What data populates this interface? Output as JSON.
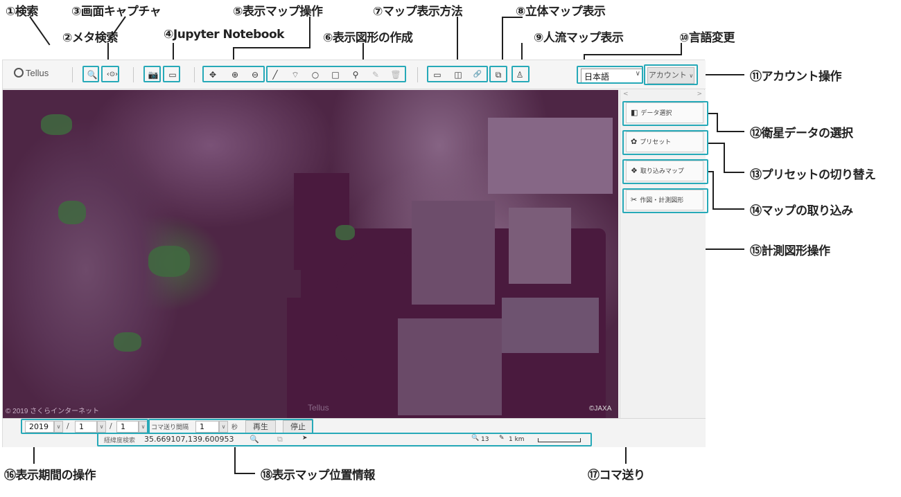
{
  "annotations": {
    "a1": "①検索",
    "a2": "②メタ検索",
    "a3": "③画面キャプチャ",
    "a4": "④Jupyter Notebook",
    "a5": "⑤表示マップ操作",
    "a6": "⑥表示図形の作成",
    "a7": "⑦マップ表示方法",
    "a8": "⑧立体マップ表示",
    "a9": "⑨人流マップ表示",
    "a10": "⑩言語変更",
    "a11": "⑪アカウント操作",
    "a12": "⑫衛星データの選択",
    "a13": "⑬プリセットの切り替え",
    "a14": "⑭マップの取り込み",
    "a15": "⑮計測図形操作",
    "a16": "⑯表示期間の操作",
    "a17": "⑰コマ送り",
    "a18": "⑱表示マップ位置情報"
  },
  "toolbar": {
    "logo": "Tellus",
    "language": "日本語",
    "account": "アカウント",
    "icons": {
      "search": "🔍",
      "meta": "‹⊙›",
      "capture": "📷",
      "notebook": "▭",
      "move": "✥",
      "zoom_in": "⊕",
      "zoom_out": "⊖",
      "line": "╱",
      "lasso": "⌔",
      "circle": "○",
      "rect": "□",
      "pin": "⚲",
      "edit": "✎",
      "trash": "🗑",
      "single": "▭",
      "split": "◫",
      "link": "🔗",
      "cube": "⧉",
      "person": "♙"
    }
  },
  "map": {
    "credit_left": "© 2019 さくらインターネット",
    "credit_right": "©JAXA",
    "watermark": "Tellus"
  },
  "panel": {
    "arrow_left": "<",
    "arrow_right": ">",
    "data_select": "データ選択",
    "preset": "プリセット",
    "import_map": "取り込みマップ",
    "drawing": "作図・計測図形",
    "icons": {
      "data": "◧",
      "preset": "✿",
      "import": "❖",
      "drawing": "✂"
    }
  },
  "time": {
    "year": "2019",
    "month": "1",
    "day": "1",
    "sep": "/",
    "interval_label": "コマ送り間隔",
    "interval": "1",
    "unit": "秒",
    "play": "再生",
    "stop": "停止",
    "arrow": "∨"
  },
  "position": {
    "label": "経緯度検索",
    "coords": "35.669107,139.600953",
    "zoom": "13",
    "scale": "1 km",
    "icons": {
      "search": "🔍",
      "copy": "⧉",
      "pointer": "➤",
      "zoom": "🔍",
      "pencil": "✎"
    }
  }
}
